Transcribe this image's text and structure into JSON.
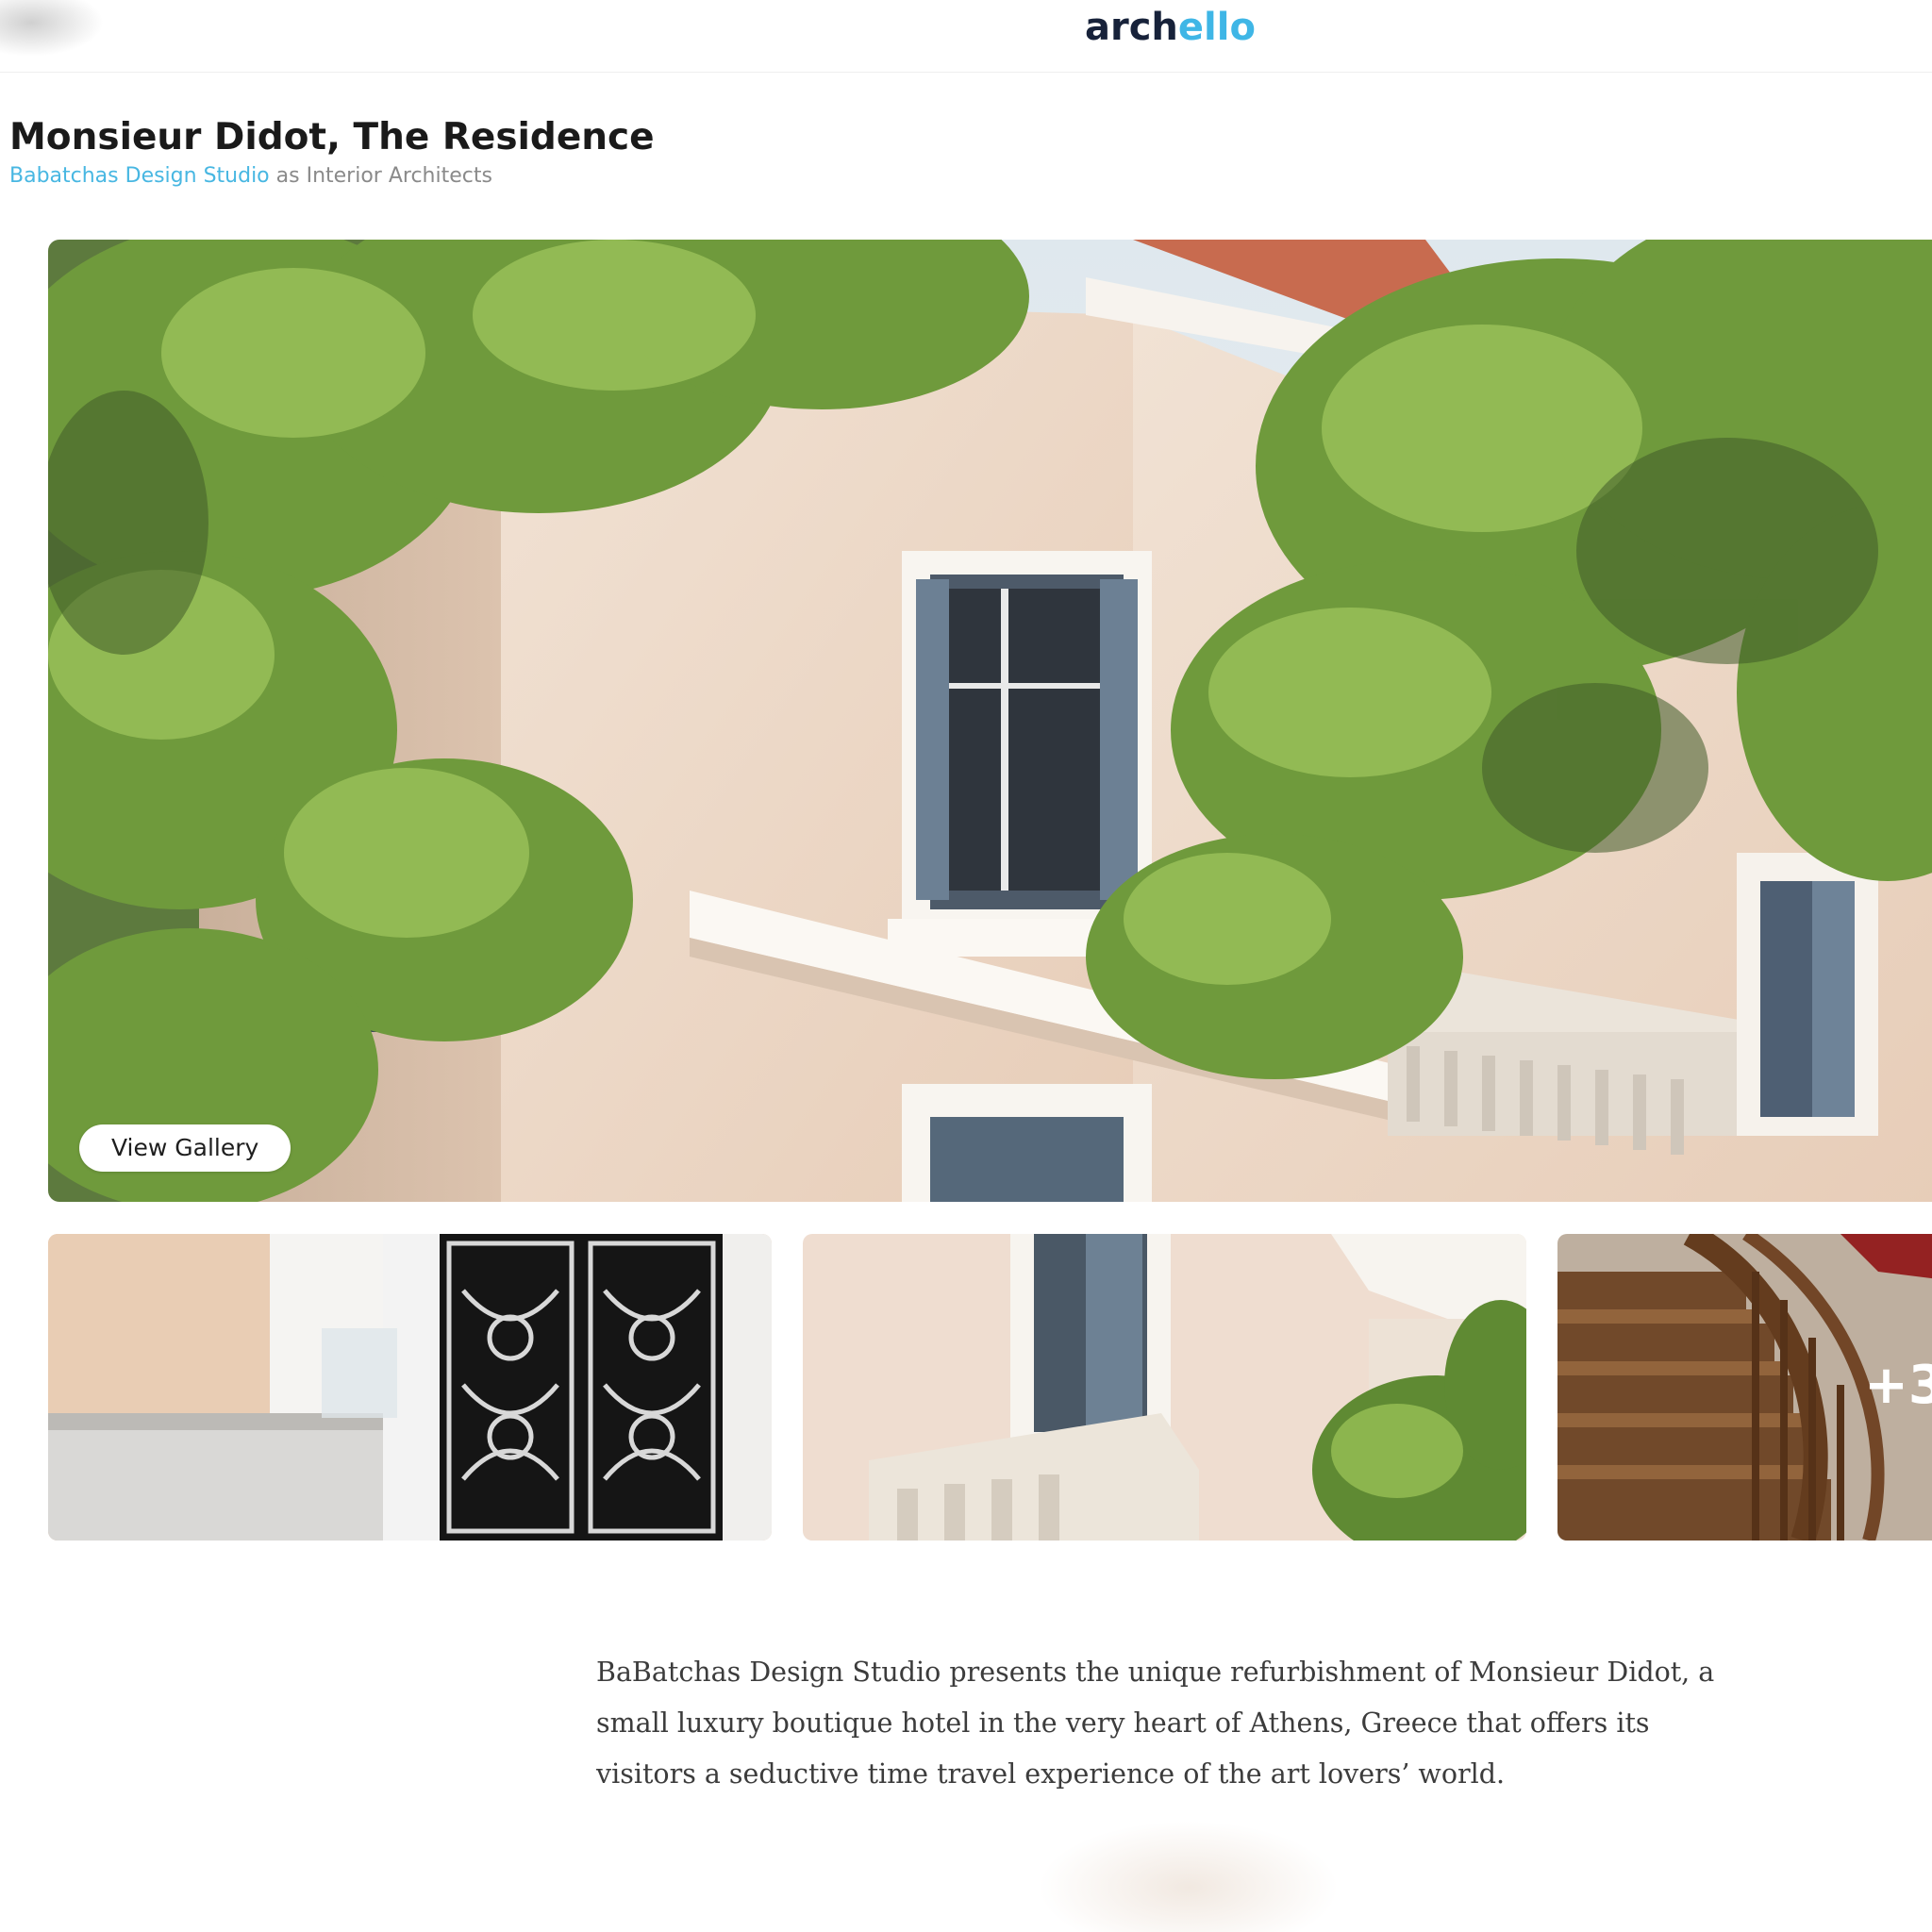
{
  "header": {
    "logo_part1": "arch",
    "logo_part2": "ello"
  },
  "project": {
    "title": "Monsieur Didot, The Residence",
    "studio_name": "Babatchas Design Studio",
    "role_text": " as Interior Architects"
  },
  "gallery": {
    "button_label": "View Gallery",
    "more_count": "+3"
  },
  "description": "BaBatchas Design Studio presents the unique refurbishment of Monsieur Didot, a small luxury boutique hotel in the very heart of Athens, Greece that offers its visitors a seductive time travel experience of the art lovers’ world.",
  "colors": {
    "brand_dark": "#17223a",
    "brand_blue": "#3fb6e6",
    "link": "#48b7e2"
  }
}
